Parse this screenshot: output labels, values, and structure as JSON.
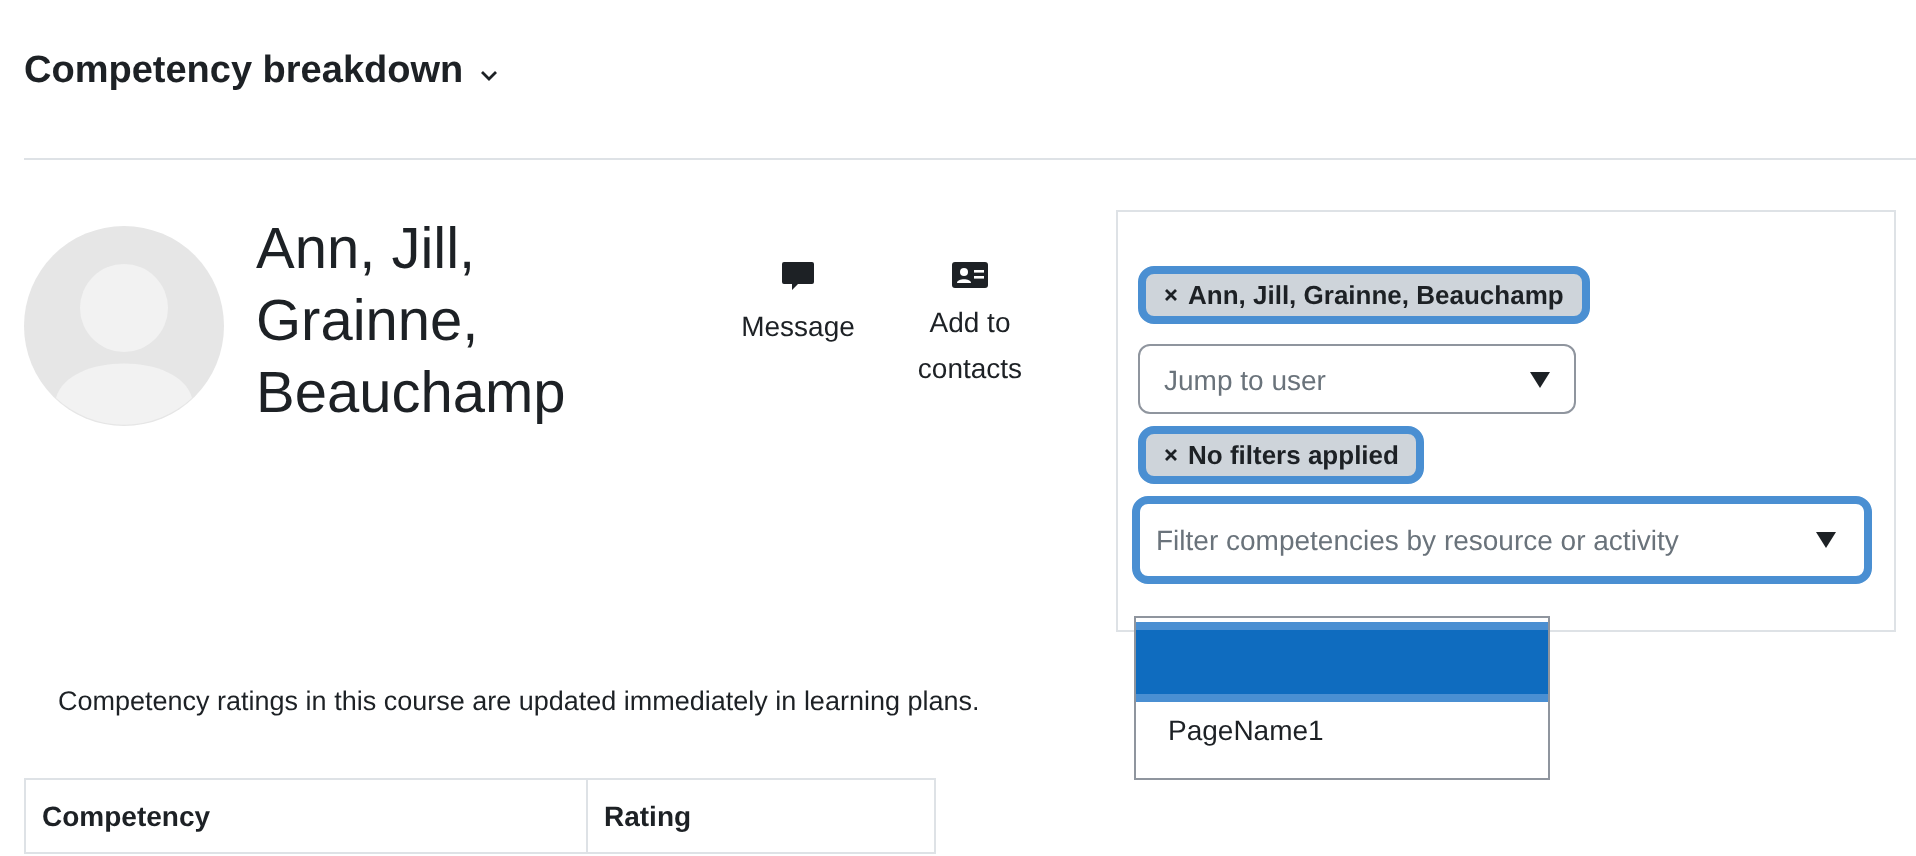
{
  "page_title": "Competency breakdown",
  "user": {
    "name": "Ann, Jill, Grainne, Beauchamp",
    "actions": [
      {
        "kind": "message",
        "label": "Message"
      },
      {
        "kind": "contact",
        "label": "Add to contacts"
      }
    ]
  },
  "filters": {
    "selected_user": "Ann, Jill, Grainne, Beauchamp",
    "jump_placeholder": "Jump to user",
    "selected_filter": "No filters applied",
    "filter_placeholder": "Filter competencies by resource or activity",
    "options": [
      {
        "selected": true
      },
      {
        "label": "PageName1",
        "selected": false
      }
    ]
  },
  "notice": "Competency ratings in this course are updated immediately in learning plans.",
  "table": {
    "columns": [
      "Competency",
      "Rating"
    ]
  }
}
